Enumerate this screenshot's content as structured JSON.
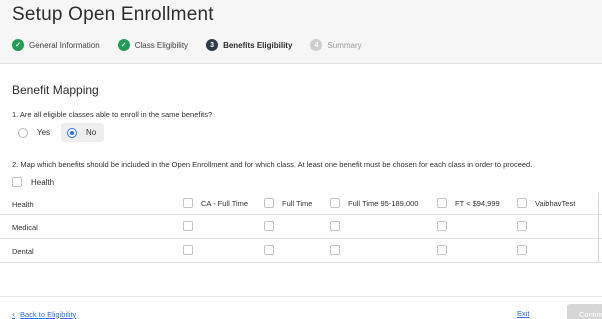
{
  "header": {
    "title": "Setup Open Enrollment",
    "steps": [
      {
        "label": "General Information",
        "marker": "",
        "state": "done"
      },
      {
        "label": "Class Eligibility",
        "marker": "",
        "state": "done"
      },
      {
        "label": "Benefits Eligibility",
        "marker": "3",
        "state": "current"
      },
      {
        "label": "Summary",
        "marker": "4",
        "state": "pending"
      }
    ]
  },
  "section": {
    "title": "Benefit Mapping",
    "question1": "1. Are all eligible classes able to enroll in the same benefits?",
    "yes_label": "Yes",
    "no_label": "No",
    "selected": "No",
    "question2": "2. Map which benefits should be included in the Open Enrollment and for which class. At least one benefit must be chosen for each class in order to proceed."
  },
  "health_toggle": {
    "label": "Health",
    "checked": false
  },
  "table": {
    "row_header": "Health",
    "columns": [
      "CA - Full Time",
      "Full Time",
      "Full Time 95-189,000",
      "FT < $94,999",
      "VaibhavTest"
    ],
    "rows": [
      {
        "label": "Medical"
      },
      {
        "label": "Dental"
      }
    ]
  },
  "footer": {
    "back_label": "Back to Eligibility",
    "exit_label": "Exit",
    "continue_label": "Continue"
  },
  "colors": {
    "done": "#1f9d55",
    "active": "#2f3b45",
    "link": "#2f6fe0",
    "disabled_button": "#d6d6d6"
  },
  "icons": [
    "check-circle-icon",
    "radio-icon",
    "checkbox-icon",
    "chevron-left-icon"
  ]
}
